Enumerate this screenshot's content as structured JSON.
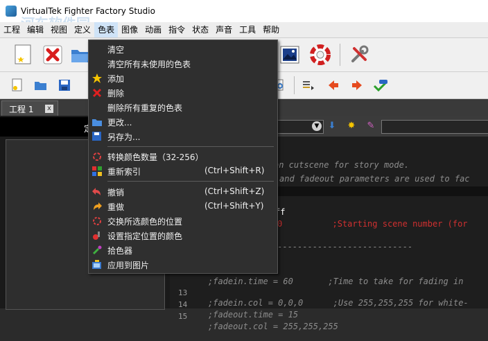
{
  "window": {
    "title": "VirtualTek Fighter Factory Studio"
  },
  "watermark": "河东软件园",
  "menubar": {
    "items": [
      "工程",
      "编辑",
      "视图",
      "定义",
      "色表",
      "图像",
      "动画",
      "指令",
      "状态",
      "声音",
      "工具",
      "帮助"
    ],
    "active_index": 4
  },
  "tab": {
    "label": "工程 1",
    "close": "x"
  },
  "left_header": "定",
  "context_menu": {
    "items": [
      {
        "label": "清空",
        "shortcut": "",
        "icon": "none"
      },
      {
        "label": "清空所有未使用的色表",
        "shortcut": "",
        "icon": "none"
      },
      {
        "label": "添加",
        "shortcut": "",
        "icon": "star-add-icon"
      },
      {
        "label": "删除",
        "shortcut": "",
        "icon": "red-x-icon"
      },
      {
        "label": "删除所有重复的色表",
        "shortcut": "",
        "icon": "none"
      },
      {
        "label": "更改...",
        "shortcut": "",
        "icon": "folder-open-icon"
      },
      {
        "label": "另存为...",
        "shortcut": "",
        "icon": "save-icon"
      },
      {
        "label": "转换颜色数量（32-256）",
        "shortcut": "",
        "icon": "convert-colors-icon"
      },
      {
        "label": "重新索引",
        "shortcut": "(Ctrl+Shift+R)",
        "icon": "reindex-icon"
      },
      {
        "label": "撤销",
        "shortcut": "(Ctrl+Shift+Z)",
        "icon": "undo-icon"
      },
      {
        "label": "重做",
        "shortcut": "(Ctrl+Shift+Y)",
        "icon": "redo-icon"
      },
      {
        "label": "交换所选颜色的位置",
        "shortcut": "",
        "icon": "swap-colors-icon"
      },
      {
        "label": "设置指定位置的颜色",
        "shortcut": "",
        "icon": "set-color-icon"
      },
      {
        "label": "拾色器",
        "shortcut": "",
        "icon": "color-picker-icon"
      },
      {
        "label": "应用到图片",
        "shortcut": "",
        "icon": "apply-image-icon"
      }
    ]
  },
  "code": {
    "lines": [
      {
        "num": "",
        "text": "on cutscene for story mode."
      },
      {
        "num": "",
        "text": "and fadeout parameters are used to fac"
      },
      {
        "num": "",
        "text": "ff"
      },
      {
        "num": "",
        "text": "0          ;Starting scene number (for"
      },
      {
        "num": "",
        "text": "---------------------------"
      },
      {
        "num": "",
        "text": ";fadein.time = 60       ;Time to take for fading in"
      },
      {
        "num": "13",
        "text": ";fadein.col = 0,0,0      ;Use 255,255,255 for white-"
      },
      {
        "num": "14",
        "text": ";fadeout.time = 15"
      },
      {
        "num": "15",
        "text": ";fadeout.col = 255,255,255"
      }
    ]
  },
  "colors": {
    "menu_bg": "#2f2f2f",
    "menu_text": "#f0f0f0",
    "editor_bg": "#1e1e1e",
    "comment_text": "#8c8c8c",
    "red_value": "#d03030"
  }
}
